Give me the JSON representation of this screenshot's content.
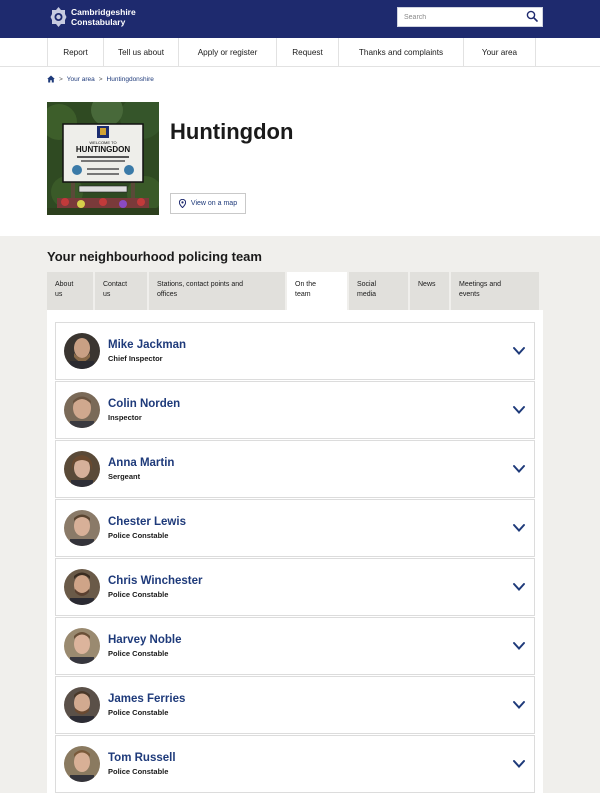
{
  "header": {
    "logo_line1": "Cambridgeshire",
    "logo_line2": "Constabulary",
    "search_placeholder": "Search"
  },
  "nav": {
    "items": [
      {
        "label": "Report"
      },
      {
        "label": "Tell us about"
      },
      {
        "label": "Apply or register"
      },
      {
        "label": "Request"
      },
      {
        "label": "Thanks and complaints"
      },
      {
        "label": "Your area"
      }
    ]
  },
  "breadcrumb": {
    "items": [
      "Your area",
      "Huntingdonshire"
    ]
  },
  "page": {
    "title": "Huntingdon",
    "map_button": "View on a map"
  },
  "sign": {
    "welcome": "WELCOME TO",
    "town": "HUNTINGDON"
  },
  "team_section": {
    "title": "Your neighbourhood policing team",
    "tabs": [
      {
        "line1": "About",
        "line2": "us"
      },
      {
        "line1": "Contact",
        "line2": "us"
      },
      {
        "line1": "Stations, contact points and",
        "line2": "offices"
      },
      {
        "line1": "On the",
        "line2": "team"
      },
      {
        "line1": "Social",
        "line2": "media"
      },
      {
        "line1": "News",
        "line2": ""
      },
      {
        "line1": "Meetings and",
        "line2": "events"
      }
    ],
    "active_tab": "On the team",
    "members": [
      {
        "name": "Mike Jackman",
        "role": "Chief Inspector"
      },
      {
        "name": "Colin Norden",
        "role": "Inspector"
      },
      {
        "name": "Anna Martin",
        "role": "Sergeant"
      },
      {
        "name": "Chester Lewis",
        "role": "Police Constable"
      },
      {
        "name": "Chris Winchester",
        "role": "Police Constable"
      },
      {
        "name": "Harvey Noble",
        "role": "Police Constable"
      },
      {
        "name": "James Ferries",
        "role": "Police Constable"
      },
      {
        "name": "Tom Russell",
        "role": "Police Constable"
      }
    ]
  },
  "colors": {
    "brand_navy": "#1e2a6e",
    "link_blue": "#1e3a7a",
    "section_bg": "#f0efec",
    "tab_bg": "#e1e0dc"
  }
}
